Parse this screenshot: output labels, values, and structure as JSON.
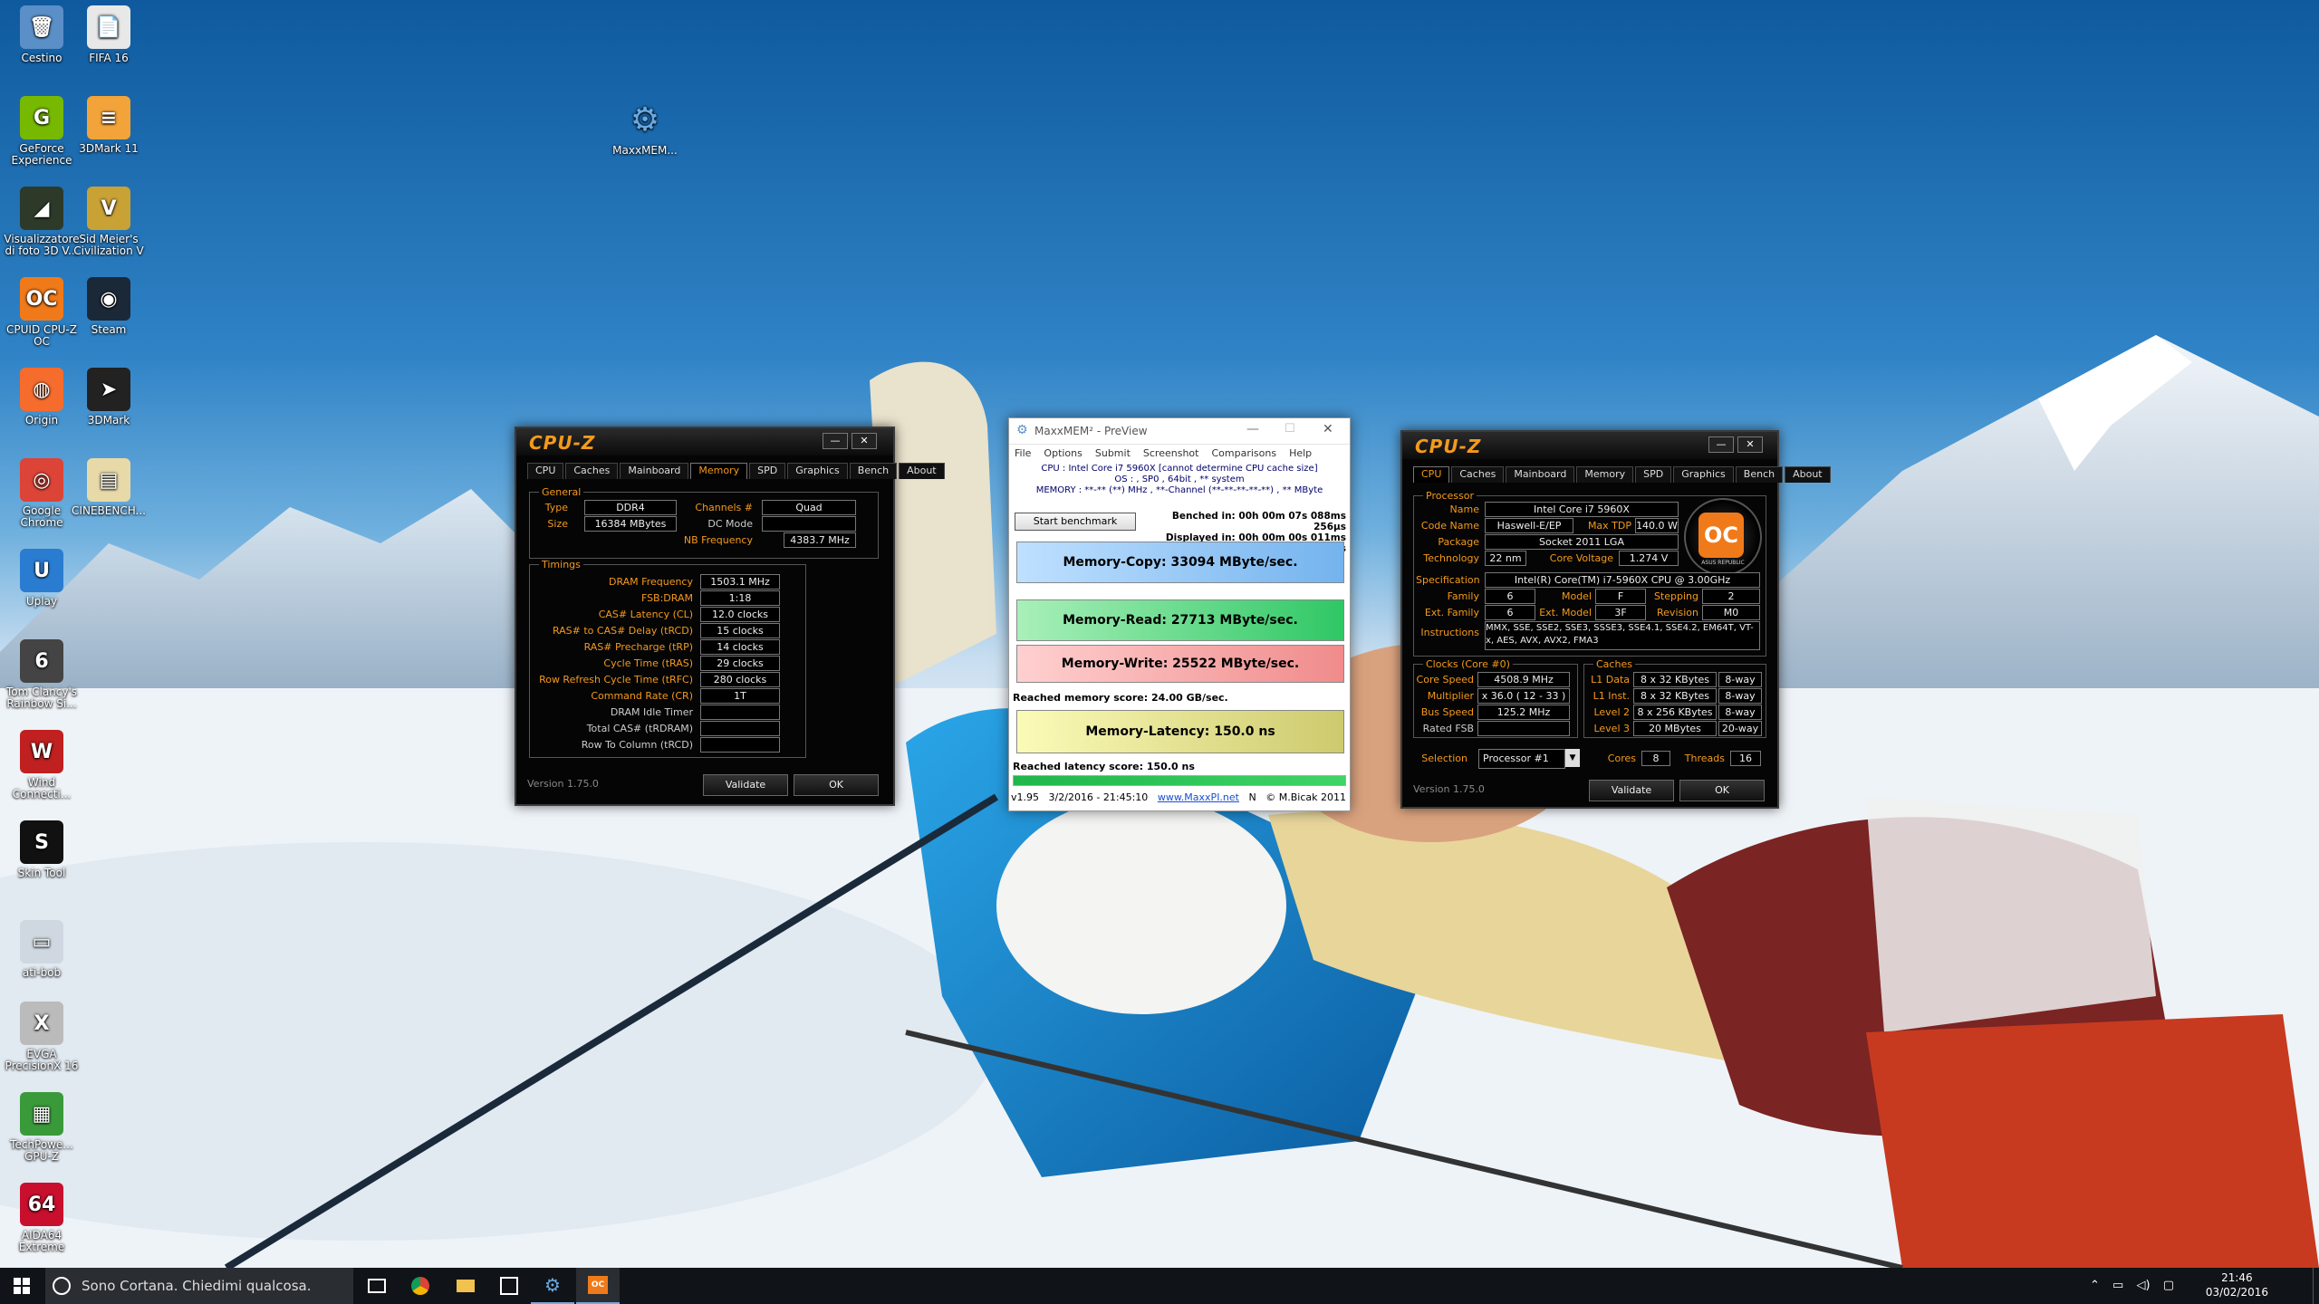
{
  "desktop": {
    "icons": [
      {
        "label": "Cestino",
        "glyph": "🗑",
        "color": "#5a8fc8"
      },
      {
        "label": "FIFA 16",
        "glyph": "📄",
        "color": "#e8e8e8"
      },
      {
        "label": "GeForce Experience",
        "glyph": "G",
        "color": "#76b900"
      },
      {
        "label": "3DMark 11",
        "glyph": "≡",
        "color": "#f2a33a"
      },
      {
        "label": "Visualizzatore di foto 3D V...",
        "glyph": "◢",
        "color": "#2d3a2a"
      },
      {
        "label": "Sid Meier's Civilization V",
        "glyph": "V",
        "color": "#c9a235"
      },
      {
        "label": "CPUID CPU-Z OC",
        "glyph": "OC",
        "color": "#f07a1a"
      },
      {
        "label": "Steam",
        "glyph": "◉",
        "color": "#1b2838"
      },
      {
        "label": "Origin",
        "glyph": "◍",
        "color": "#f56c2d"
      },
      {
        "label": "3DMark",
        "glyph": "➤",
        "color": "#222"
      },
      {
        "label": "Google Chrome",
        "glyph": "◎",
        "color": "#db4437"
      },
      {
        "label": "CINEBENCH...",
        "glyph": "▤",
        "color": "#e8d9a8"
      },
      {
        "label": "Uplay",
        "glyph": "U",
        "color": "#2a7cd1"
      },
      {
        "label": "Tom Clancy's Rainbow Si...",
        "glyph": "6",
        "color": "#444"
      },
      {
        "label": "Wind Connecti...",
        "glyph": "W",
        "color": "#c02020"
      },
      {
        "label": "Skin Tool",
        "glyph": "S",
        "color": "#111"
      },
      {
        "label": "ati-bob",
        "glyph": "▭",
        "color": "#cfd8e0"
      },
      {
        "label": "EVGA PrecisionX 16",
        "glyph": "X",
        "color": "#bbb"
      },
      {
        "label": "TechPowe... GPU-Z",
        "glyph": "▦",
        "color": "#3a9a3a"
      },
      {
        "label": "AIDA64 Extreme",
        "glyph": "64",
        "color": "#c8102e"
      }
    ],
    "maxxmem_icon_label": "MaxxMEM..."
  },
  "cpuz_memory": {
    "logo": "CPU-Z",
    "tabs": [
      "CPU",
      "Caches",
      "Mainboard",
      "Memory",
      "SPD",
      "Graphics",
      "Bench",
      "About"
    ],
    "active_tab": "Memory",
    "general_title": "General",
    "type_label": "Type",
    "type_value": "DDR4",
    "size_label": "Size",
    "size_value": "16384 MBytes",
    "channels_label": "Channels #",
    "channels_value": "Quad",
    "dcmode_label": "DC Mode",
    "dcmode_value": "",
    "nbfreq_label": "NB Frequency",
    "nbfreq_value": "4383.7 MHz",
    "timings_title": "Timings",
    "timings": [
      {
        "label": "DRAM Frequency",
        "value": "1503.1 MHz"
      },
      {
        "label": "FSB:DRAM",
        "value": "1:18"
      },
      {
        "label": "CAS# Latency (CL)",
        "value": "12.0 clocks"
      },
      {
        "label": "RAS# to CAS# Delay (tRCD)",
        "value": "15 clocks"
      },
      {
        "label": "RAS# Precharge (tRP)",
        "value": "14 clocks"
      },
      {
        "label": "Cycle Time (tRAS)",
        "value": "29 clocks"
      },
      {
        "label": "Row Refresh Cycle Time (tRFC)",
        "value": "280 clocks"
      },
      {
        "label": "Command Rate (CR)",
        "value": "1T"
      },
      {
        "label": "DRAM Idle Timer",
        "value": ""
      },
      {
        "label": "Total CAS# (tRDRAM)",
        "value": ""
      },
      {
        "label": "Row To Column (tRCD)",
        "value": ""
      }
    ],
    "version": "Version 1.75.0",
    "validate": "Validate",
    "ok": "OK"
  },
  "maxxmem": {
    "title": "MaxxMEM² - PreView",
    "menu": [
      "File",
      "Options",
      "Submit",
      "Screenshot",
      "Comparisons",
      "Help"
    ],
    "cpu_line": "CPU : Intel Core i7 5960X  [cannot determine CPU cache size]",
    "os_line": "OS : , SP0 , 64bit , ** system",
    "mem_line": "MEMORY : **-** (**) MHz , **-Channel (**-**-**-**-**) , ** MByte",
    "start_button": "Start benchmark",
    "benched": "Benched in: 00h 00m 07s 088ms 256µs",
    "displayed": "Displayed in: 00h 00m 00s 011ms 695µs",
    "copy": "Memory-Copy: 33094 MByte/sec.",
    "read": "Memory-Read: 27713 MByte/sec.",
    "write": "Memory-Write: 25522 MByte/sec.",
    "mem_score": "Reached memory score: 24.00 GB/sec.",
    "latency": "Memory-Latency: 150.0 ns",
    "lat_score": "Reached latency score: 150.0 ns",
    "status_version": "v1.95",
    "status_date": "3/2/2016 - 21:45:10",
    "status_link": "www.MaxxPI.net",
    "status_n": "N",
    "status_author": "© M.Bicak 2011",
    "progress": 1.0
  },
  "cpuz_cpu": {
    "logo": "CPU-Z",
    "tabs": [
      "CPU",
      "Caches",
      "Mainboard",
      "Memory",
      "SPD",
      "Graphics",
      "Bench",
      "About"
    ],
    "active_tab": "CPU",
    "processor_title": "Processor",
    "name_label": "Name",
    "name_value": "Intel Core i7 5960X",
    "codename_label": "Code Name",
    "codename_value": "Haswell-E/EP",
    "maxtdp_label": "Max TDP",
    "maxtdp_value": "140.0 W",
    "package_label": "Package",
    "package_value": "Socket 2011 LGA",
    "tech_label": "Technology",
    "tech_value": "22 nm",
    "voltage_label": "Core Voltage",
    "voltage_value": "1.274 V",
    "spec_label": "Specification",
    "spec_value": "Intel(R) Core(TM) i7-5960X CPU @ 3.00GHz",
    "family_label": "Family",
    "family_value": "6",
    "model_label": "Model",
    "model_value": "F",
    "stepping_label": "Stepping",
    "stepping_value": "2",
    "extfamily_label": "Ext. Family",
    "extfamily_value": "6",
    "extmodel_label": "Ext. Model",
    "extmodel_value": "3F",
    "revision_label": "Revision",
    "revision_value": "M0",
    "instr_label": "Instructions",
    "instr_value": "MMX, SSE, SSE2, SSE3, SSSE3, SSE4.1, SSE4.2, EM64T, VT-x, AES, AVX, AVX2, FMA3",
    "clocks_title": "Clocks (Core #0)",
    "corespeed_label": "Core Speed",
    "corespeed_value": "4508.9 MHz",
    "multiplier_label": "Multiplier",
    "multiplier_value": "x 36.0 ( 12 - 33 )",
    "busspeed_label": "Bus Speed",
    "busspeed_value": "125.2 MHz",
    "ratedfsb_label": "Rated FSB",
    "ratedfsb_value": "",
    "caches_title": "Caches",
    "l1d_label": "L1 Data",
    "l1d_value": "8 x 32 KBytes",
    "l1d_way": "8-way",
    "l1i_label": "L1 Inst.",
    "l1i_value": "8 x 32 KBytes",
    "l1i_way": "8-way",
    "l2_label": "Level 2",
    "l2_value": "8 x 256 KBytes",
    "l2_way": "8-way",
    "l3_label": "Level 3",
    "l3_value": "20 MBytes",
    "l3_way": "20-way",
    "selection_label": "Selection",
    "selection_value": "Processor #1",
    "cores_label": "Cores",
    "cores_value": "8",
    "threads_label": "Threads",
    "threads_value": "16",
    "badge_text": "OC",
    "badge_sub": "ASUS REPUBLIC",
    "version": "Version 1.75.0",
    "validate": "Validate",
    "ok": "OK"
  },
  "taskbar": {
    "search_placeholder": "Sono Cortana. Chiedimi qualcosa.",
    "time": "21:46",
    "date": "03/02/2016"
  },
  "colors": {
    "cpuz_orange": "#f39a1c",
    "copy_bar": "#8fc3f2",
    "read_bar": "#4fd37a",
    "write_bar": "#f2a0a0",
    "latency_bar": "#e2e084"
  }
}
